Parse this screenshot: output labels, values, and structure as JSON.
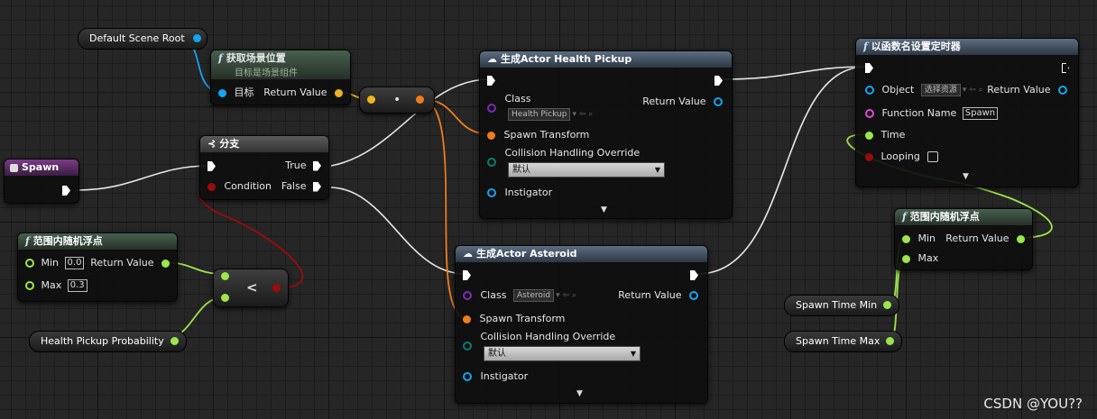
{
  "colors": {
    "exec": "#ffffff",
    "object": "#12a5f0",
    "struct": "#f0b41e",
    "transform": "#f07c1e",
    "bool": "#9b0b0b",
    "float": "#9be64b",
    "class": "#7a2bb8",
    "enum": "#0b7a73",
    "function_name": "#e14bd8"
  },
  "nodes": {
    "default_scene_root": {
      "label": "Default Scene Root",
      "pin": "object"
    },
    "get_location": {
      "icon": "function-icon",
      "title": "获取场景位置",
      "subtitle": "目标是场景组件",
      "target": "目标",
      "return": "Return Value"
    },
    "make_transform": {
      "symbol": "•"
    },
    "spawn_event": {
      "icon": "event-icon",
      "title": "Spawn"
    },
    "branch": {
      "icon": "branch-icon",
      "title": "分支",
      "condition": "Condition",
      "true": "True",
      "false": "False"
    },
    "spawn_health": {
      "icon": "spawn-icon",
      "title": "生成Actor Health Pickup",
      "class_label": "Class",
      "class_value": "Health Pickup",
      "return": "Return Value",
      "spawn_transform": "Spawn Transform",
      "collision_label": "Collision Handling Override",
      "collision_value": "默认",
      "instigator": "Instigator"
    },
    "spawn_asteroid": {
      "icon": "spawn-icon",
      "title": "生成Actor Asteroid",
      "class_label": "Class",
      "class_value": "Asteroid",
      "return": "Return Value",
      "spawn_transform": "Spawn Transform",
      "collision_label": "Collision Handling Override",
      "collision_value": "默认",
      "instigator": "Instigator"
    },
    "random_float_1": {
      "icon": "function-icon",
      "title": "范围内随机浮点",
      "min": "Min",
      "min_value": "0.0",
      "max": "Max",
      "max_value": "0.3",
      "return": "Return Value"
    },
    "less_than": {
      "symbol": "<"
    },
    "health_pickup_probability": {
      "label": "Health Pickup Probability"
    },
    "set_timer": {
      "icon": "function-icon",
      "title": "以函数名设置定时器",
      "object_label": "Object",
      "object_value": "选择资源",
      "function_name_label": "Function Name",
      "function_name_value": "Spawn",
      "time_label": "Time",
      "looping_label": "Looping",
      "looping_checked": false
    },
    "random_float_2": {
      "icon": "function-icon",
      "title": "范围内随机浮点",
      "min": "Min",
      "max": "Max",
      "return": "Return Value"
    },
    "spawn_time_min": {
      "label": "Spawn Time Min"
    },
    "spawn_time_max": {
      "label": "Spawn Time Max"
    }
  },
  "watermark": "CSDN @YOU??"
}
